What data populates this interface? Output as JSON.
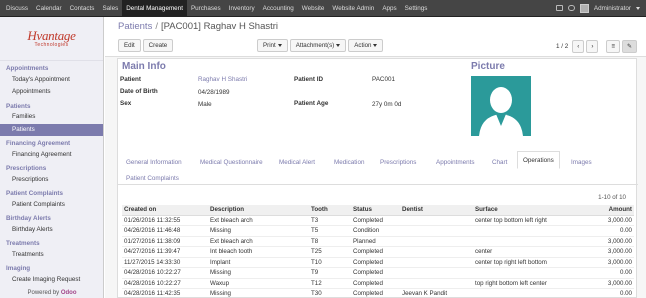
{
  "topbar": {
    "menu": [
      "Discuss",
      "Calendar",
      "Contacts",
      "Sales",
      "Dental Management",
      "Purchases",
      "Inventory",
      "Accounting",
      "Website",
      "Website Admin",
      "Apps",
      "Settings"
    ],
    "active_index": 4,
    "user": "Administrator"
  },
  "logo": {
    "name": "Hvantage",
    "tagline": "Technologies"
  },
  "sidebar": [
    {
      "type": "section",
      "label": "Appointments"
    },
    {
      "type": "item",
      "label": "Today's Appointment"
    },
    {
      "type": "item",
      "label": "Appointments"
    },
    {
      "type": "section",
      "label": "Patients"
    },
    {
      "type": "item",
      "label": "Families"
    },
    {
      "type": "item",
      "label": "Patients",
      "selected": true
    },
    {
      "type": "section",
      "label": "Financing Agreement"
    },
    {
      "type": "item",
      "label": "Financing Agreement"
    },
    {
      "type": "section",
      "label": "Prescriptions"
    },
    {
      "type": "item",
      "label": "Prescriptions"
    },
    {
      "type": "section",
      "label": "Patient Complaints"
    },
    {
      "type": "item",
      "label": "Patient Complaints"
    },
    {
      "type": "section",
      "label": "Birthday Alerts"
    },
    {
      "type": "item",
      "label": "Birthday Alerts"
    },
    {
      "type": "section",
      "label": "Treatments"
    },
    {
      "type": "item",
      "label": "Treatments"
    },
    {
      "type": "section",
      "label": "Imaging"
    },
    {
      "type": "item",
      "label": "Create Imaging Request"
    }
  ],
  "powered": {
    "prefix": "Powered by",
    "brand": "Odoo"
  },
  "breadcrumb": {
    "parent": "Patients",
    "sep": "/",
    "current": "[PAC001] Raghav H Shastri"
  },
  "toolbar": {
    "edit": "Edit",
    "create": "Create",
    "print": "Print",
    "attachments": "Attachment(s)",
    "action": "Action",
    "pager": "1 / 2"
  },
  "form": {
    "title": "Main Info",
    "picture_title": "Picture",
    "patient_label": "Patient",
    "patient_value": "Raghav H Shastri",
    "dob_label": "Date of Birth",
    "dob_value": "04/28/1989",
    "sex_label": "Sex",
    "sex_value": "Male",
    "pid_label": "Patient ID",
    "pid_value": "PAC001",
    "age_label": "Patient Age",
    "age_value": "27y 0m 0d"
  },
  "tabs": [
    "General Information",
    "Medical Questionnaire",
    "Medical Alert",
    "Medication",
    "Prescriptions",
    "Appointments",
    "Chart",
    "Operations",
    "Images",
    "Patient Complaints"
  ],
  "active_tab": 7,
  "operations": {
    "pager": "1-10 of 10",
    "columns": [
      "Created on",
      "Description",
      "Tooth",
      "Status",
      "Dentist",
      "Surface",
      "Amount"
    ],
    "rows": [
      [
        "01/26/2016 11:32:55",
        "Ext bleach arch",
        "T3",
        "Completed",
        "",
        "center top bottom left right",
        "3,000.00"
      ],
      [
        "04/26/2016 11:46:48",
        "Missing",
        "T5",
        "Condition",
        "",
        "",
        "0.00"
      ],
      [
        "01/27/2016 11:38:09",
        "Ext bleach arch",
        "T8",
        "Planned",
        "",
        "",
        "3,000.00"
      ],
      [
        "04/27/2016 11:39:47",
        "Int bleach tooth",
        "T25",
        "Completed",
        "",
        "center",
        "3,000.00"
      ],
      [
        "11/27/2015 14:33:30",
        "Implant",
        "T10",
        "Completed",
        "",
        "center top right left bottom",
        "3,000.00"
      ],
      [
        "04/28/2016 10:22:27",
        "Missing",
        "T9",
        "Completed",
        "",
        "",
        "0.00"
      ],
      [
        "04/28/2016 10:22:27",
        "Waxup",
        "T12",
        "Completed",
        "",
        "top right bottom left center",
        "3,000.00"
      ],
      [
        "04/28/2016 11:42:35",
        "Missing",
        "T30",
        "Completed",
        "Jeevan K Pandit",
        "",
        "0.00"
      ]
    ]
  }
}
